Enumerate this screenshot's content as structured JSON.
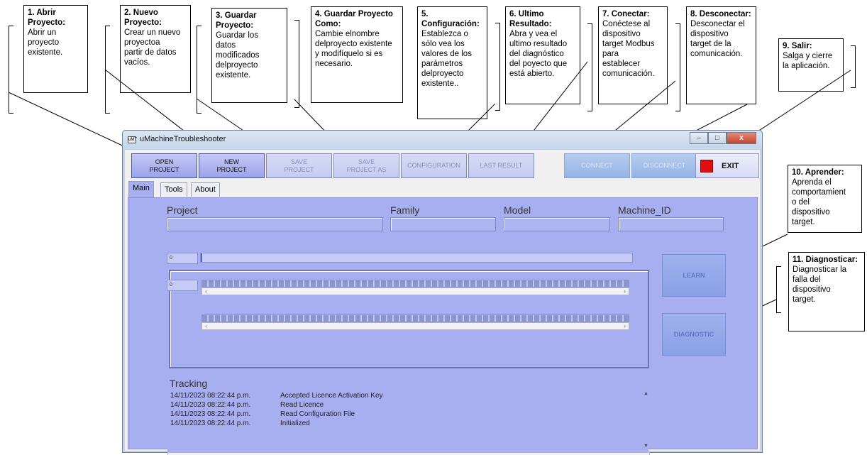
{
  "callouts": [
    {
      "title": "1. Abrir Proyecto:",
      "body": "  Abrir un\nproyecto\nexistente."
    },
    {
      "title": "2. Nuevo Proyecto:",
      "body": "Crear un nuevo\nproyectoa\npartir de datos\nvacíos."
    },
    {
      "title": "3. Guardar Proyecto:",
      "body": "Guardar los\ndatos\nmodificados\ndelproyecto\nexistente."
    },
    {
      "title": "4. Guardar Proyecto Como:",
      "body": "Cambie elnombre\ndelproyecto existente\ny modifíquelo si es\nnecesario."
    },
    {
      "title": "5. Configuración:",
      "body": "Establezca o\nsólo vea los\nvalores de los\nparámetros\ndelproyecto\nexistente.."
    },
    {
      "title": "6. Ultimo Resultado:",
      "body": "Abra y vea el\nultimo resultado\ndel diagnóstico\ndel poyecto que\nestá abierto."
    },
    {
      "title": "7. Conectar:",
      "body": "Conéctese al\ndispositivo\ntarget Modbus\npara\nestablecer\ncomunicación."
    },
    {
      "title": "8. Desconectar:",
      "body": "Desconectar el\ndispositivo\ntarget de la\ncomunicación."
    },
    {
      "title": "9. Salir:",
      "body": " Salga y cierre\nla aplicación."
    },
    {
      "title": "10. Aprender:",
      "body": " Aprenda el\ncomportamient\no del\ndispositivo\ntarget."
    },
    {
      "title": "11. Diagnosticar:",
      "body": "Diagnosticar la\nfalla del\ndispositivo\ntarget."
    }
  ],
  "window": {
    "title": "uMachineTroubleshooter",
    "app_icon": "uMT",
    "icons": {
      "minimize": "minimize-icon",
      "maximize": "maximize-icon",
      "close": "close-icon"
    }
  },
  "toolbar": {
    "open_project": "OPEN\nPROJECT",
    "new_project": "NEW\nPROJECT",
    "save_project": "SAVE\nPROJECT",
    "save_project_as": "SAVE\nPROJECT AS",
    "configuration": "CONFIGURATION",
    "last_result": "LAST RESULT",
    "connect": "CONNECT",
    "disconnect": "DISCONNECT",
    "exit": "EXIT"
  },
  "tabs": [
    {
      "label": "Main",
      "active": true
    },
    {
      "label": "Tools",
      "active": false
    },
    {
      "label": "About",
      "active": false
    }
  ],
  "fields": {
    "project": {
      "label": "Project",
      "value": ""
    },
    "family": {
      "label": "Family",
      "value": ""
    },
    "model": {
      "label": "Model",
      "value": ""
    },
    "machine_id": {
      "label": "Machine_ID",
      "value": ""
    }
  },
  "progress": {
    "counter1": "0",
    "counter2": "0",
    "fraction": 0
  },
  "side_buttons": {
    "learn": "LEARN",
    "diagnostic": "DIAGNOSTIC"
  },
  "tracking": {
    "label": "Tracking",
    "entries": [
      {
        "ts": "14/11/2023 08:22:44 p.m.",
        "msg": "Accepted Licence Activation Key"
      },
      {
        "ts": "14/11/2023 08:22:44 p.m.",
        "msg": "Read Licence"
      },
      {
        "ts": "14/11/2023 08:22:44 p.m.",
        "msg": "Read Configuration File"
      },
      {
        "ts": "14/11/2023 08:22:44 p.m.",
        "msg": "Initialized"
      }
    ]
  },
  "colors": {
    "accent": "#9da3ea",
    "exit_led": "#e01010",
    "panel": "#a7aff0"
  }
}
